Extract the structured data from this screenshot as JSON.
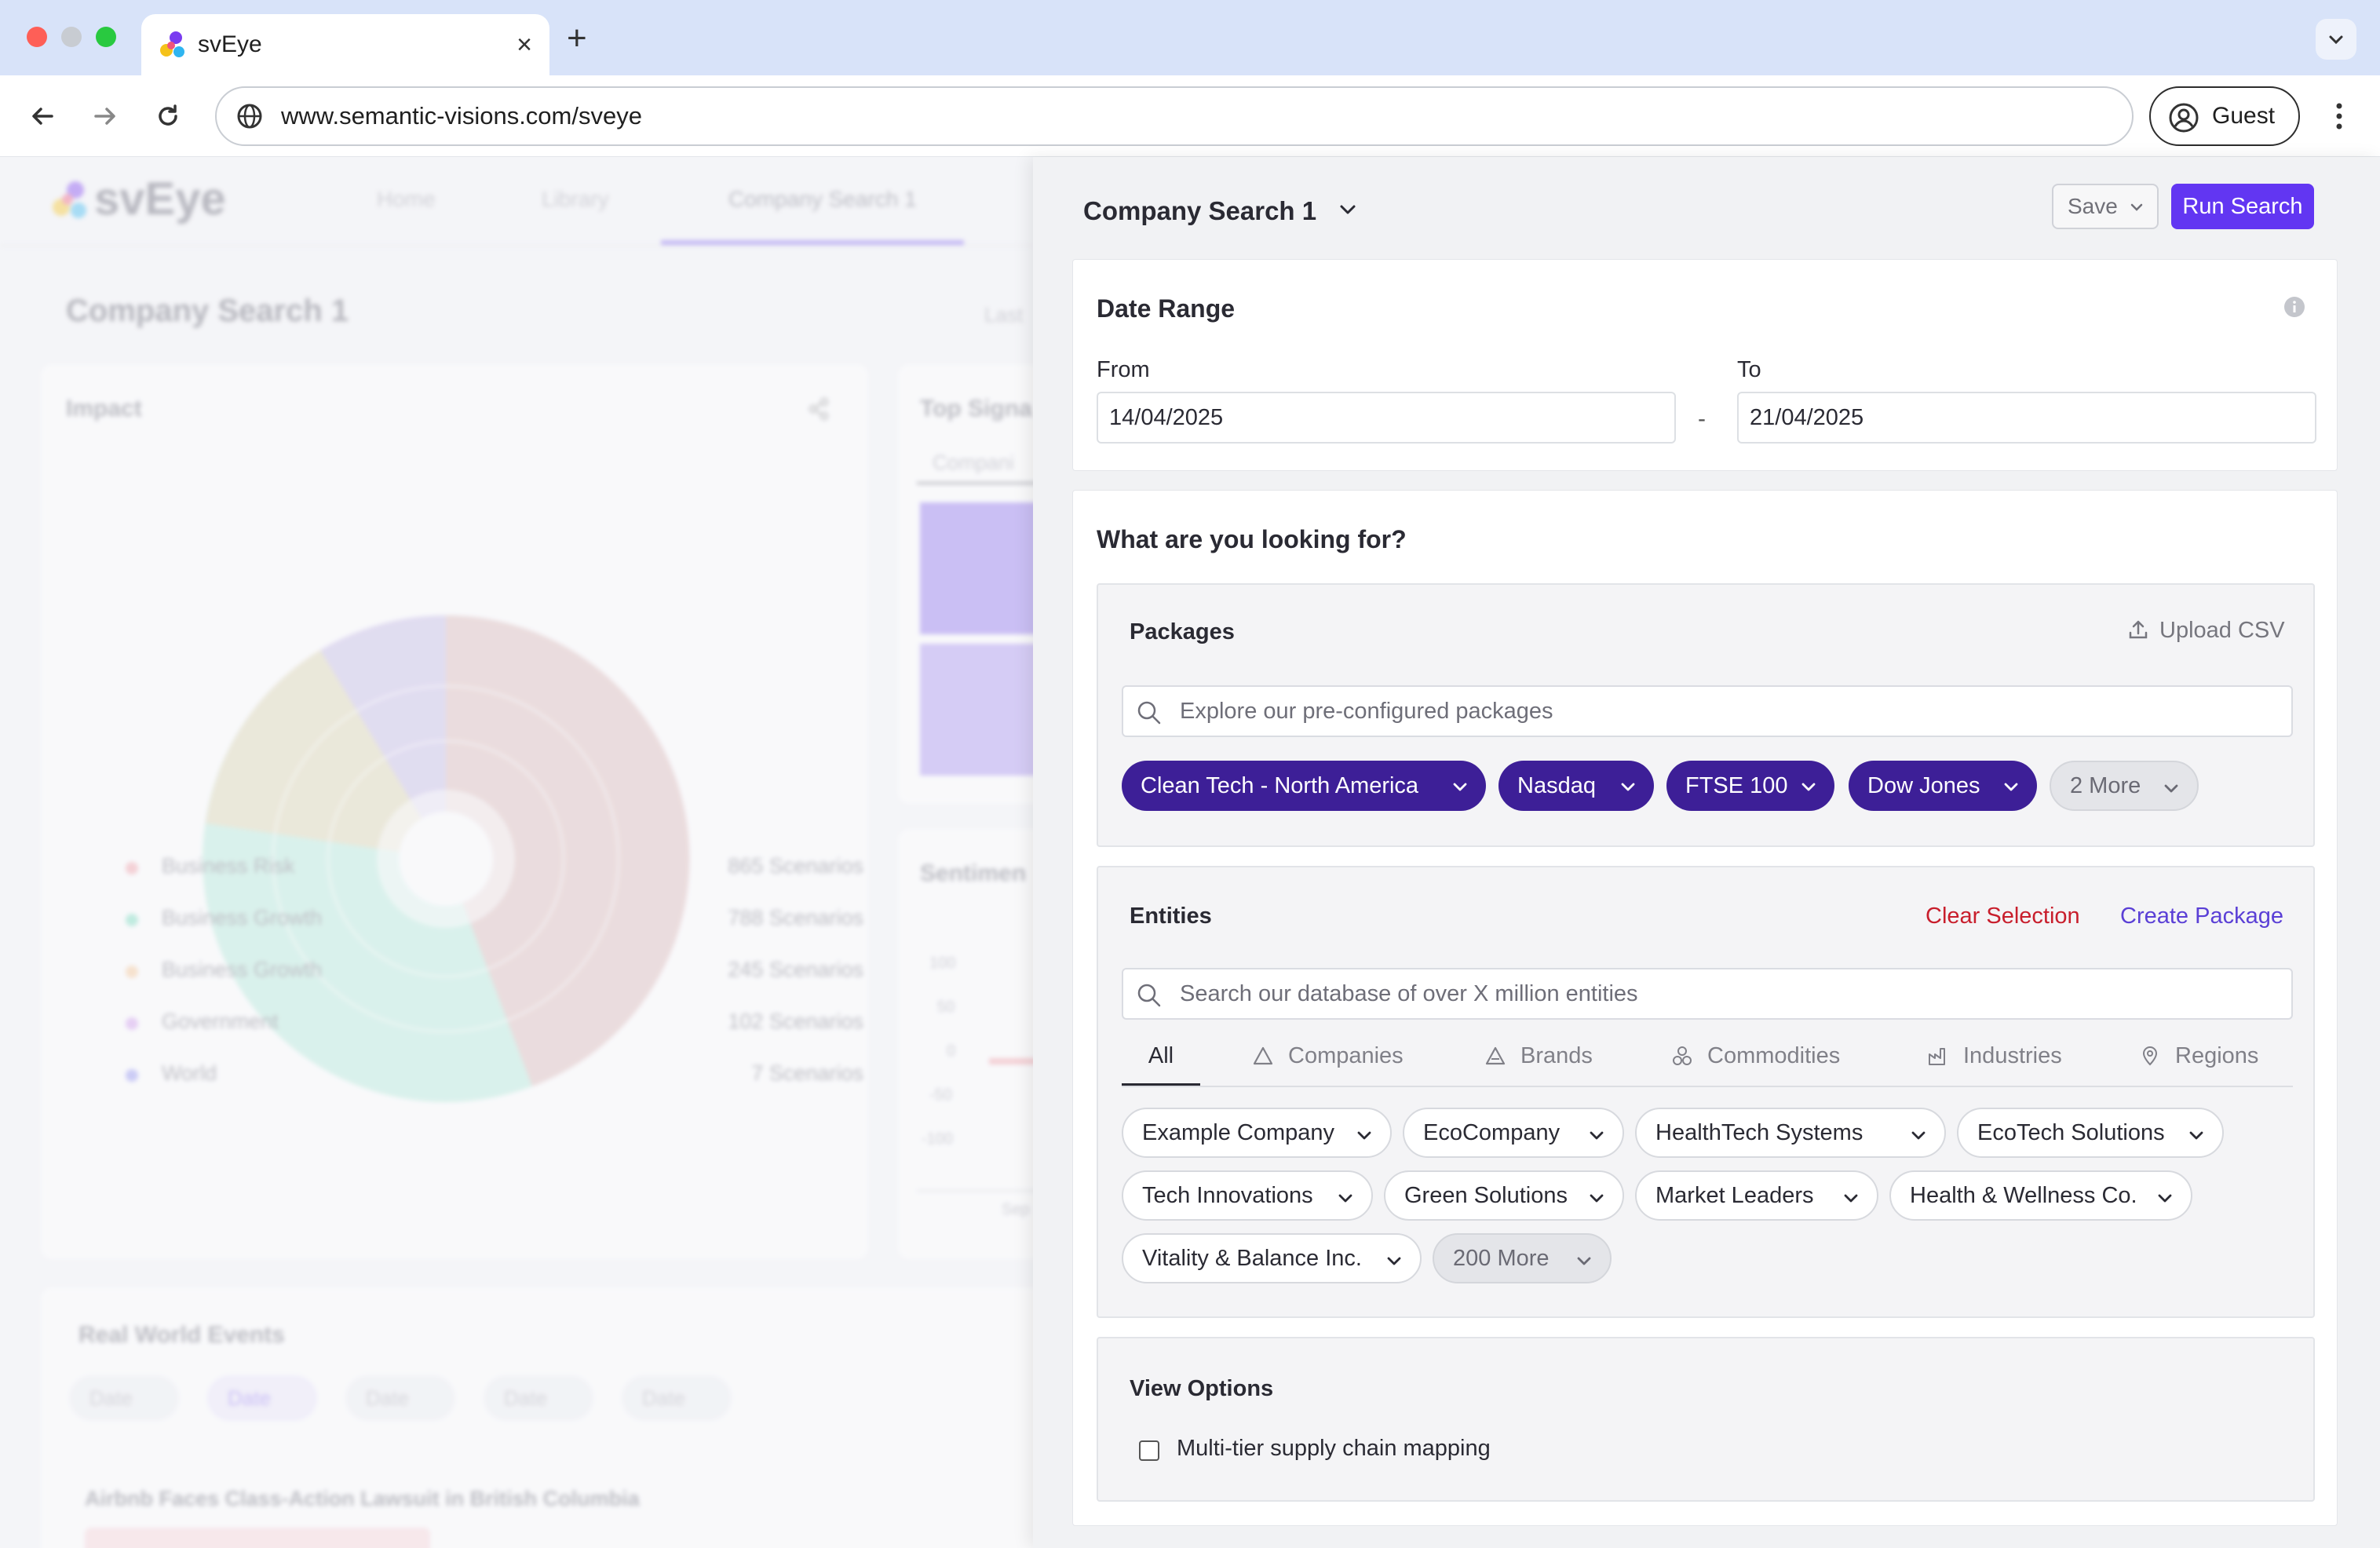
{
  "browser": {
    "tab_title": "svEye",
    "url": "www.semantic-visions.com/sveye",
    "profile_label": "Guest",
    "new_tab_symbol": "+",
    "close_symbol": "×"
  },
  "background_app": {
    "logo_text": "svEye",
    "nav": [
      "Home",
      "Library",
      "Company Search 1"
    ],
    "page_title": "Company Search 1",
    "last_label": "Last",
    "impact_title": "Impact",
    "legend": [
      {
        "label": "Business Risk",
        "count": "865 Scenarios",
        "color": "#f39aa2"
      },
      {
        "label": "Business Growth",
        "count": "788 Scenarios",
        "color": "#6fdcbb"
      },
      {
        "label": "Business Growth",
        "count": "245 Scenarios",
        "color": "#f9c58d"
      },
      {
        "label": "Government",
        "count": "102 Scenarios",
        "color": "#cf95ee"
      },
      {
        "label": "World",
        "count": "7 Scenarios",
        "color": "#8c8cf2"
      }
    ],
    "top_signals_title": "Top Signa",
    "companies_tab": "Compani",
    "sentiment_title": "Sentimen",
    "y_ticks": [
      "100",
      "50",
      "0",
      "-50",
      "-100"
    ],
    "sep_label": "Sep",
    "events_title": "Real World Events",
    "event_filters": [
      "Date",
      "Date",
      "Date",
      "Date",
      "Date"
    ],
    "event_headline": "Airbnb Faces Class-Action Lawsuit in British Columbia"
  },
  "panel": {
    "title": "Company Search 1",
    "save_label": "Save",
    "run_label": "Run Search",
    "date_range": {
      "title": "Date Range",
      "from_label": "From",
      "from_value": "14/04/2025",
      "to_label": "To",
      "to_value": "21/04/2025",
      "separator": "-"
    },
    "looking_for_title": "What are you looking for?",
    "packages": {
      "title": "Packages",
      "upload_label": "Upload CSV",
      "search_placeholder": "Explore our pre-configured packages",
      "chips": [
        "Clean Tech - North America",
        "Nasdaq",
        "FTSE 100",
        "Dow Jones"
      ],
      "more_label": "2 More"
    },
    "entities": {
      "title": "Entities",
      "clear_label": "Clear Selection",
      "create_label": "Create Package",
      "search_placeholder": "Search our database of over X million entities",
      "tabs": [
        "All",
        "Companies",
        "Brands",
        "Commodities",
        "Industries",
        "Regions"
      ],
      "chips": [
        "Example Company",
        "EcoCompany",
        "HealthTech Systems",
        "EcoTech Solutions",
        "Tech Innovations",
        "Green Solutions",
        "Market Leaders",
        "Health & Wellness Co.",
        "Vitality & Balance Inc."
      ],
      "more_label": "200 More"
    },
    "view_options": {
      "title": "View Options",
      "checkbox_label": "Multi-tier supply chain mapping",
      "checked": false
    }
  },
  "colors": {
    "accent": "#6236f2",
    "chip_dark": "#3d1f97",
    "clear_red": "#c81e2c",
    "link_purple": "#5a3fd6"
  }
}
